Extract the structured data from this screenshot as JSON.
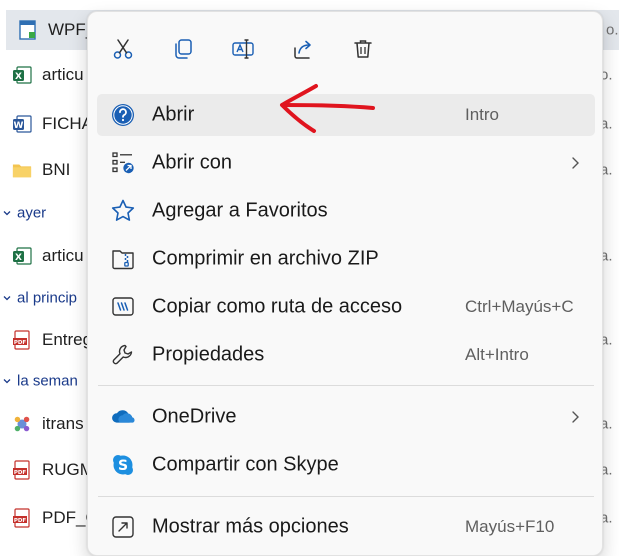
{
  "background": {
    "rows": [
      {
        "name": "WPF_",
        "icon": "document-icon",
        "right": "o."
      },
      {
        "name": "articu",
        "icon": "excel-icon",
        "right": "o."
      },
      {
        "name": "FICHA",
        "icon": "word-icon",
        "right": "a."
      },
      {
        "name": "BNI",
        "icon": "folder-icon",
        "right": "a."
      },
      {
        "name": "articu",
        "icon": "excel-icon",
        "right": "a."
      },
      {
        "name": "Entreg",
        "icon": "pdf-icon",
        "right": "a."
      },
      {
        "name": "itrans",
        "icon": "app-icon",
        "right": "a."
      },
      {
        "name": "RUGM",
        "icon": "pdf-icon",
        "right": "a."
      },
      {
        "name": "PDF_C",
        "icon": "pdf-icon",
        "right": "a."
      }
    ],
    "groups": [
      "ayer",
      "al princip",
      "la seman"
    ]
  },
  "menu": {
    "toolbar": [
      {
        "name": "cut-icon",
        "title": "Cortar"
      },
      {
        "name": "copy-icon",
        "title": "Copiar"
      },
      {
        "name": "rename-icon",
        "title": "Cambiar nombre"
      },
      {
        "name": "share-icon",
        "title": "Compartir"
      },
      {
        "name": "delete-icon",
        "title": "Eliminar"
      }
    ],
    "items": [
      {
        "label": "Abrir",
        "shortcut": "Intro",
        "icon": "help-circle-icon"
      },
      {
        "label": "Abrir con",
        "shortcut": "",
        "icon": "open-with-icon",
        "submenu": true
      },
      {
        "label": "Agregar a Favoritos",
        "shortcut": "",
        "icon": "star-icon"
      },
      {
        "label": "Comprimir en archivo ZIP",
        "shortcut": "",
        "icon": "zip-icon"
      },
      {
        "label": "Copiar como ruta de acceso",
        "shortcut": "Ctrl+Mayús+C",
        "icon": "copy-path-icon"
      },
      {
        "label": "Propiedades",
        "shortcut": "Alt+Intro",
        "icon": "wrench-icon"
      },
      {
        "label": "OneDrive",
        "shortcut": "",
        "icon": "onedrive-icon",
        "submenu": true
      },
      {
        "label": "Compartir con Skype",
        "shortcut": "",
        "icon": "skype-icon"
      },
      {
        "label": "Mostrar más opciones",
        "shortcut": "Mayús+F10",
        "icon": "more-options-icon"
      }
    ]
  },
  "colors": {
    "accent": "#1a5fb4",
    "annotation": "#e0141e",
    "group_label": "#1a3a8a",
    "onedrive": "#0f6cbd",
    "skype": "#1d8fe0"
  }
}
